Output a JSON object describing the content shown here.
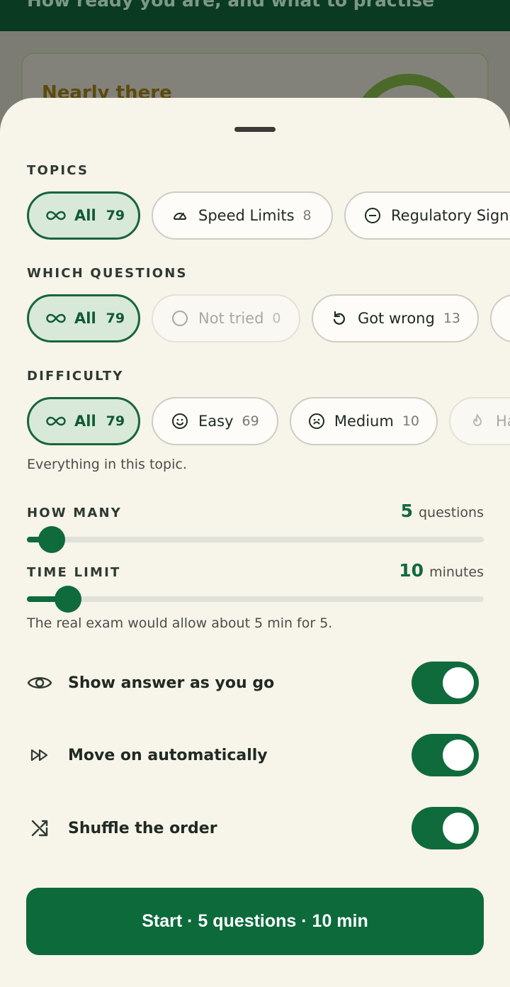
{
  "background": {
    "header_text": "How ready you are, and what to practise",
    "card_title": "Nearly there"
  },
  "topics": {
    "title": "TOPICS",
    "chips": [
      {
        "label": "All",
        "count": "79",
        "icon": "infinity-icon",
        "state": "selected"
      },
      {
        "label": "Speed Limits",
        "count": "8",
        "icon": "speedometer-icon",
        "state": "default"
      },
      {
        "label": "Regulatory Sign",
        "count": "",
        "icon": "minus-circle-icon",
        "state": "default"
      }
    ]
  },
  "which_questions": {
    "title": "WHICH QUESTIONS",
    "chips": [
      {
        "label": "All",
        "count": "79",
        "icon": "infinity-icon",
        "state": "selected"
      },
      {
        "label": "Not tried",
        "count": "0",
        "icon": "circle-icon",
        "state": "disabled"
      },
      {
        "label": "Got wrong",
        "count": "13",
        "icon": "retry-icon",
        "state": "default"
      }
    ]
  },
  "difficulty": {
    "title": "DIFFICULTY",
    "chips": [
      {
        "label": "All",
        "count": "79",
        "icon": "infinity-icon",
        "state": "selected"
      },
      {
        "label": "Easy",
        "count": "69",
        "icon": "smile-icon",
        "state": "default"
      },
      {
        "label": "Medium",
        "count": "10",
        "icon": "neutral-face-icon",
        "state": "default"
      },
      {
        "label": "Ha",
        "count": "",
        "icon": "flame-icon",
        "state": "disabled"
      }
    ],
    "helper": "Everything in this topic."
  },
  "how_many": {
    "title": "HOW MANY",
    "value": "5",
    "unit": "questions",
    "slider_fraction": 0.055
  },
  "time_limit": {
    "title": "TIME LIMIT",
    "value": "10",
    "unit": "minutes",
    "slider_fraction": 0.09,
    "helper": "The real exam would allow about 5 min for 5."
  },
  "toggles": [
    {
      "label": "Show answer as you go",
      "icon": "eye-icon",
      "on": true
    },
    {
      "label": "Move on automatically",
      "icon": "fast-forward-icon",
      "on": true
    },
    {
      "label": "Shuffle the order",
      "icon": "shuffle-icon",
      "on": true
    }
  ],
  "start_button": "Start · 5 questions · 10 min",
  "colors": {
    "primary": "#0f6a3c",
    "selected_chip_bg": "#d8e8d9",
    "sheet_bg": "#f7f4ea"
  }
}
